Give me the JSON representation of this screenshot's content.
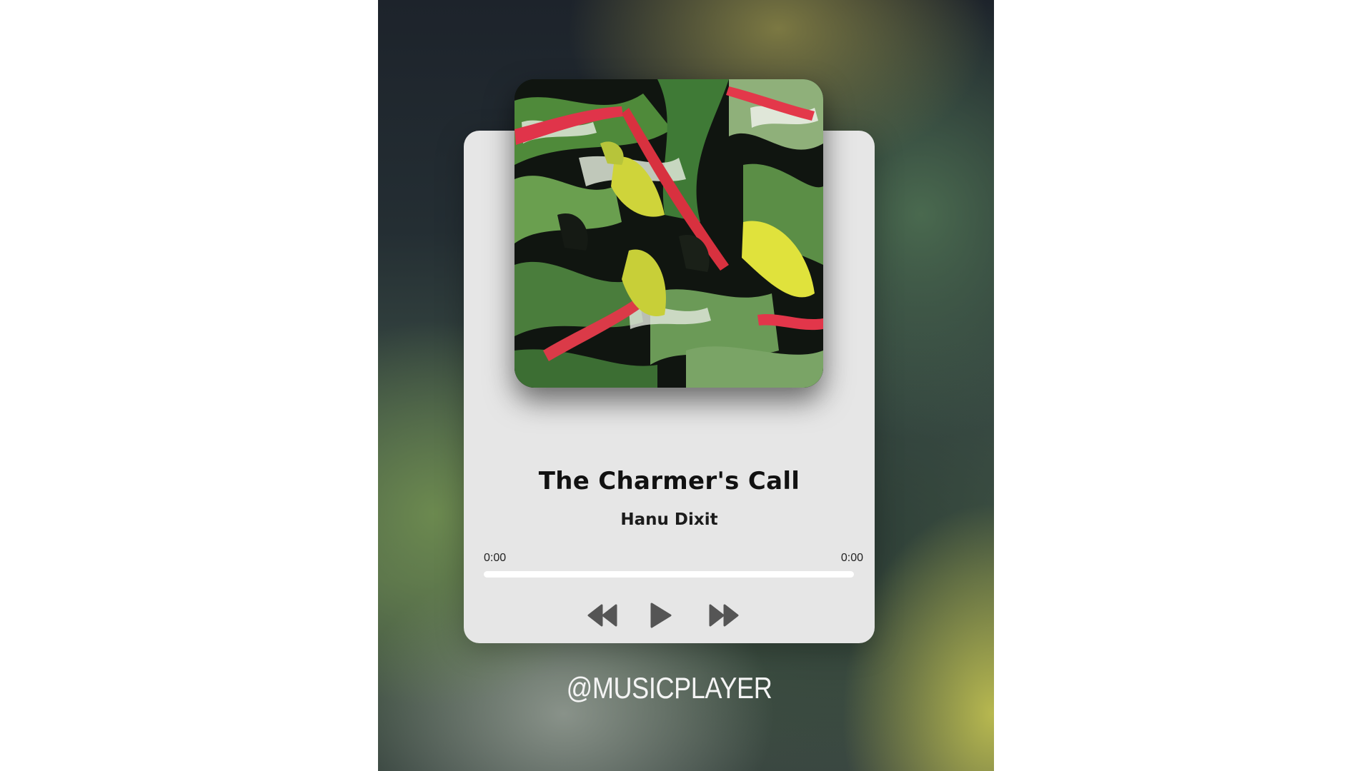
{
  "track": {
    "title": "The Charmer's Call",
    "artist": "Hanu Dixit",
    "current_time": "0:00",
    "duration": "0:00",
    "progress": 0
  },
  "controls": {
    "prev_icon": "rewind-icon",
    "play_icon": "play-icon",
    "next_icon": "fast-forward-icon"
  },
  "brand": {
    "handle": "@MUSICPLAYER"
  },
  "colors": {
    "card": "#e6e6e6",
    "control": "#555555",
    "progress_track": "#ffffff",
    "brand_text": "#f4f4f4"
  }
}
